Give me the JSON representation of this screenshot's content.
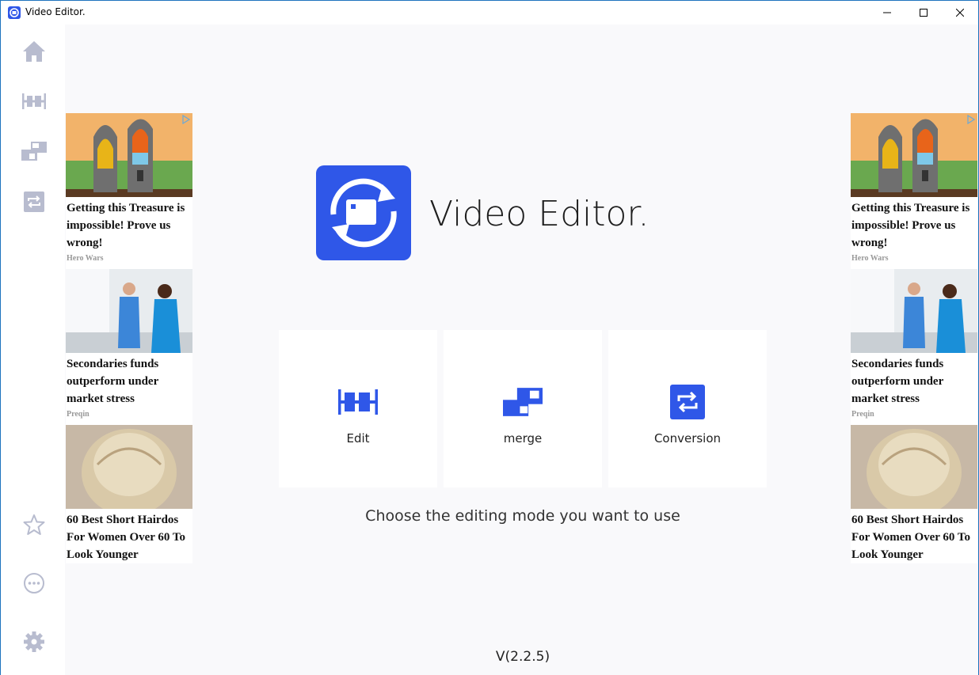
{
  "window": {
    "title": "Video Editor."
  },
  "sidebar": {
    "items": [
      {
        "icon": "home-icon"
      },
      {
        "icon": "edit-icon"
      },
      {
        "icon": "merge-icon"
      },
      {
        "icon": "conversion-icon"
      }
    ],
    "bottom_items": [
      {
        "icon": "star-icon"
      },
      {
        "icon": "more-icon"
      },
      {
        "icon": "settings-icon"
      }
    ],
    "icon_color": "#b8bccf"
  },
  "logo": {
    "title": "Video Editor.",
    "color": "#2f57e8"
  },
  "modes": [
    {
      "label": "Edit",
      "icon": "edit-icon"
    },
    {
      "label": "merge",
      "icon": "merge-icon"
    },
    {
      "label": "Conversion",
      "icon": "conversion-icon"
    }
  ],
  "accent_color": "#2f57e8",
  "hint": "Choose the editing mode you want to use",
  "version": "V(2.2.5)",
  "ads": [
    {
      "title": "Getting this Treasure is impossible! Prove us wrong!",
      "source": "Hero Wars"
    },
    {
      "title": "Secondaries funds outperform under market stress",
      "source": "Preqin"
    },
    {
      "title": "60 Best Short Hairdos For Women Over 60 To Look Younger",
      "source": ""
    }
  ]
}
